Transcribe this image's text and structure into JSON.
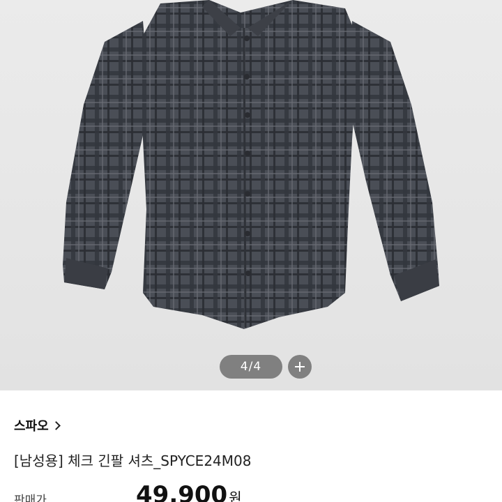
{
  "gallery": {
    "counter_current": "4",
    "counter_separator": "/",
    "counter_total": "4",
    "zoom_icon": "plus-icon"
  },
  "product": {
    "brand": "스파오",
    "brand_chevron_icon": "chevron-right-icon",
    "title": "[남성용] 체크 긴팔 셔츠_SPYCE24M08",
    "price_label": "판매가",
    "price_value": "49,900",
    "price_currency": "원"
  },
  "colors": {
    "shirt": "#4a4e56",
    "check_dark": "#2b2e34",
    "check_light": "#6a6e76",
    "background": "#e8e8e8"
  }
}
